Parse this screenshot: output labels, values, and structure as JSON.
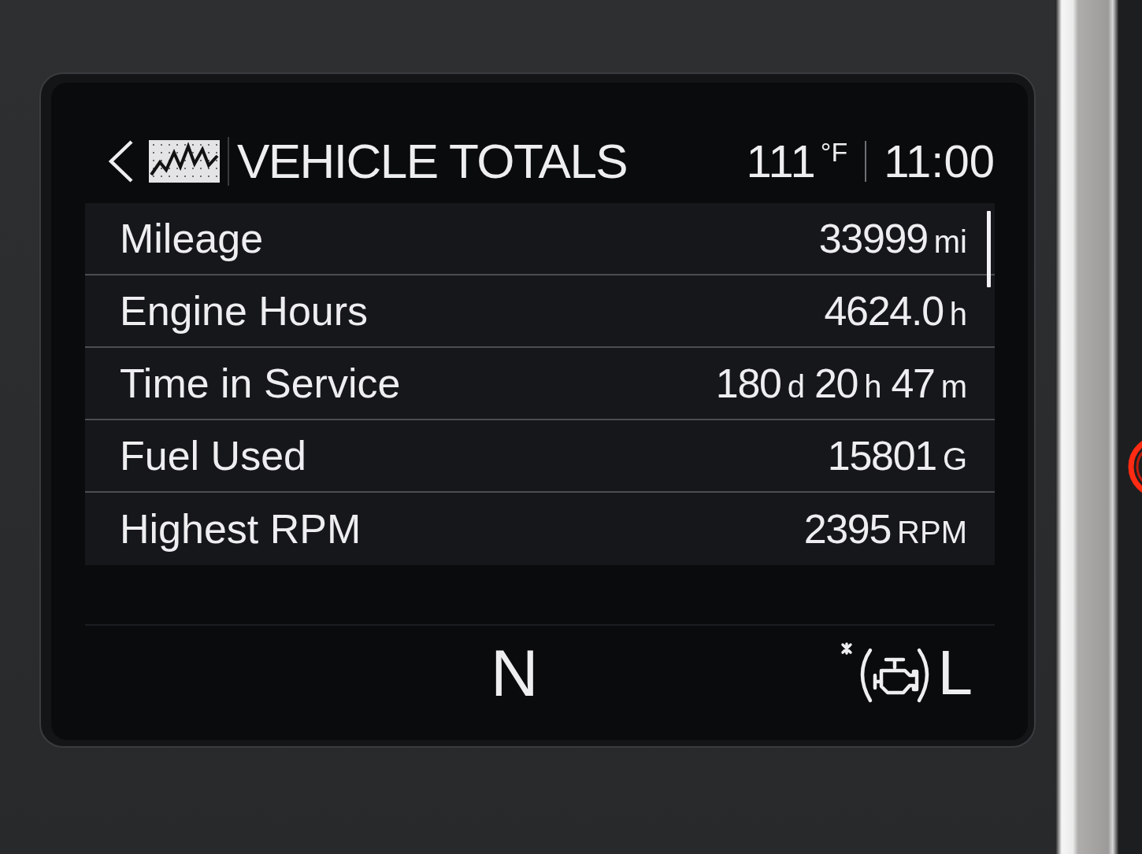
{
  "header": {
    "title": "VEHICLE TOTALS",
    "temperature": "111",
    "temperature_unit": "°F",
    "time": "11:00"
  },
  "rows": [
    {
      "label": "Mileage",
      "parts": [
        {
          "number": "33999",
          "unit": "mi"
        }
      ]
    },
    {
      "label": "Engine Hours",
      "parts": [
        {
          "number": "4624.0",
          "unit": "h"
        }
      ]
    },
    {
      "label": "Time in Service",
      "parts": [
        {
          "number": "180",
          "unit": "d"
        },
        {
          "number": "20",
          "unit": "h"
        },
        {
          "number": "47",
          "unit": "m"
        }
      ]
    },
    {
      "label": "Fuel Used",
      "parts": [
        {
          "number": "15801",
          "unit": "G"
        }
      ]
    },
    {
      "label": "Highest RPM",
      "parts": [
        {
          "number": "2395",
          "unit": "RPM"
        }
      ]
    }
  ],
  "bottom_bar": {
    "gear": "N",
    "indicator_letter": "L"
  }
}
